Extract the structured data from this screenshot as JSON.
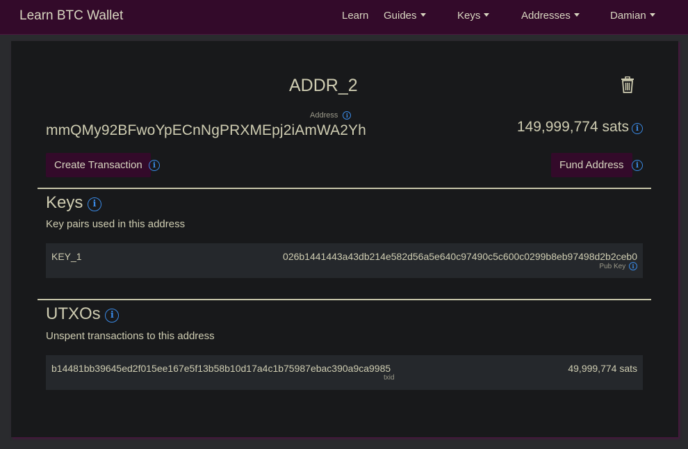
{
  "nav": {
    "brand": "Learn BTC Wallet",
    "items": [
      {
        "label": "Learn",
        "dropdown": false
      },
      {
        "label": "Guides",
        "dropdown": true
      },
      {
        "label": "Keys",
        "dropdown": true
      },
      {
        "label": "Addresses",
        "dropdown": true
      },
      {
        "label": "Damian",
        "dropdown": true
      }
    ]
  },
  "address": {
    "name": "ADDR_2",
    "label": "Address",
    "value": "mmQMy92BFwoYpECnNgPRXMEpj2iAmWA2Yh",
    "balance": "149,999,774 sats"
  },
  "actions": {
    "create_transaction": "Create Transaction",
    "fund_address": "Fund Address"
  },
  "keys": {
    "title": "Keys",
    "subtitle": "Key pairs used in this address",
    "items": [
      {
        "name": "KEY_1",
        "pubkey": "026b1441443a43db214e582d56a5e640c97490c5c600c0299b8eb97498d2b2ceb0",
        "pubkey_label": "Pub Key"
      }
    ]
  },
  "utxos": {
    "title": "UTXOs",
    "subtitle": "Unspent transactions to this address",
    "items": [
      {
        "txid": "b14481bb39645ed2f015ee167e5f13b58b10d17a4c1b75987ebac390a9ca9985",
        "txid_label": "txid",
        "amount": "49,999,774 sats"
      }
    ]
  },
  "colors": {
    "navbar": "#330a2a",
    "card": "#18191b",
    "info_icon": "#3a8ae6",
    "text": "#cfcdb2"
  }
}
